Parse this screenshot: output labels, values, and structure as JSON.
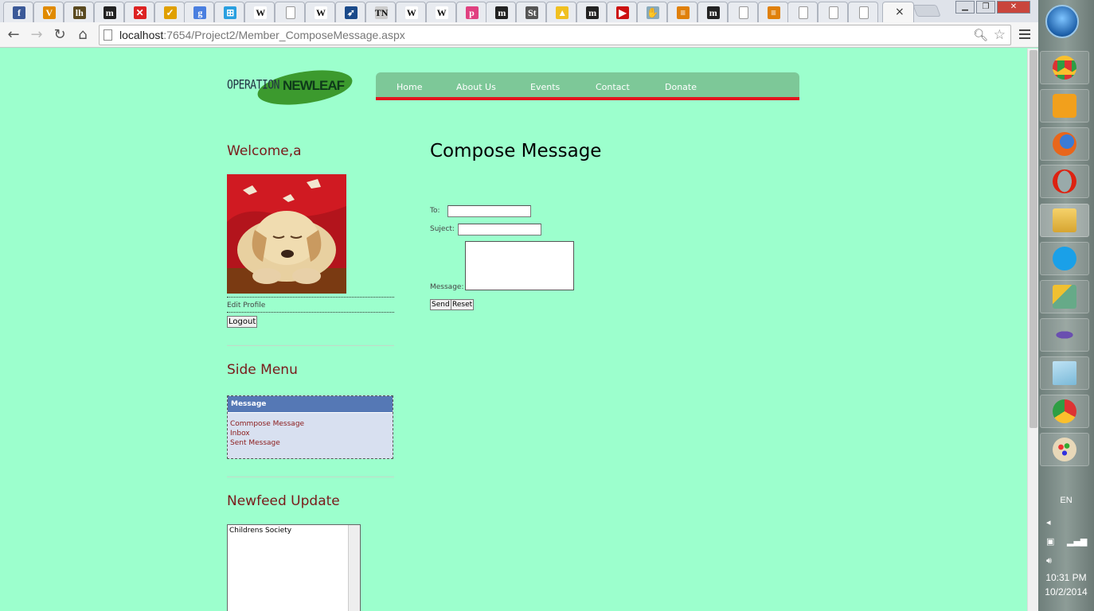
{
  "browser": {
    "url_host": "localhost",
    "url_path": ":7654/Project2/Member_ComposeMessage.aspx",
    "tabs": [
      {
        "icon": "facebook-icon",
        "glyph": "f",
        "color": "#3b5998"
      },
      {
        "icon": "v-icon",
        "glyph": "V",
        "color": "#e08a00"
      },
      {
        "icon": "lh-icon",
        "glyph": "lh",
        "color": "#5a4a20"
      },
      {
        "icon": "m-icon",
        "glyph": "m",
        "color": "#222222"
      },
      {
        "icon": "x-app-icon",
        "glyph": "✕",
        "color": "#d22"
      },
      {
        "icon": "check-icon",
        "glyph": "✓",
        "color": "#e0a000"
      },
      {
        "icon": "google-icon",
        "glyph": "g",
        "color": "#4a7fe0"
      },
      {
        "icon": "windows-icon",
        "glyph": "⊞",
        "color": "#2aa0e0"
      },
      {
        "icon": "wikipedia-icon",
        "glyph": "W",
        "color": "#ffffff"
      },
      {
        "icon": "blank-page-icon",
        "glyph": "",
        "color": "#ffffff"
      },
      {
        "icon": "wikipedia-icon",
        "glyph": "W",
        "color": "#ffffff"
      },
      {
        "icon": "bird-icon",
        "glyph": "➶",
        "color": "#1a4a8a"
      },
      {
        "icon": "tn-icon",
        "glyph": "TN",
        "color": "#cccccc"
      },
      {
        "icon": "wikipedia-icon",
        "glyph": "W",
        "color": "#ffffff"
      },
      {
        "icon": "wikipedia-icon",
        "glyph": "W",
        "color": "#ffffff"
      },
      {
        "icon": "p-icon",
        "glyph": "p",
        "color": "#e04080"
      },
      {
        "icon": "m-icon",
        "glyph": "m",
        "color": "#222222"
      },
      {
        "icon": "st-icon",
        "glyph": "St",
        "color": "#555555"
      },
      {
        "icon": "drive-icon",
        "glyph": "▲",
        "color": "#f0c020"
      },
      {
        "icon": "m-icon",
        "glyph": "m",
        "color": "#222222"
      },
      {
        "icon": "youtube-icon",
        "glyph": "▶",
        "color": "#c11"
      },
      {
        "icon": "hand-icon",
        "glyph": "✋",
        "color": "#8ab"
      },
      {
        "icon": "stack-icon",
        "glyph": "≡",
        "color": "#e0800a"
      },
      {
        "icon": "m-icon",
        "glyph": "m",
        "color": "#222222"
      },
      {
        "icon": "blank-page-icon",
        "glyph": "",
        "color": "#ffffff"
      },
      {
        "icon": "stack-icon",
        "glyph": "≡",
        "color": "#e0800a"
      },
      {
        "icon": "blank-page-icon",
        "glyph": "",
        "color": "#ffffff"
      },
      {
        "icon": "blank-page-icon",
        "glyph": "",
        "color": "#ffffff"
      },
      {
        "icon": "blank-page-icon",
        "glyph": "",
        "color": "#ffffff"
      }
    ],
    "active_tab_close": "×"
  },
  "logo": {
    "part1": "OPERATION",
    "part2": "NEWLEAF"
  },
  "nav": [
    "Home",
    "About Us",
    "Events",
    "Contact",
    "Donate"
  ],
  "sidebar": {
    "welcome": "Welcome,a",
    "edit_profile": "Edit Profile",
    "logout": "Logout",
    "side_menu_title": "Side Menu",
    "menu_header": "Message",
    "menu_items": [
      "Commpose Message",
      "Inbox",
      "Sent Message"
    ],
    "news_title": "Newfeed Update",
    "news_items": [
      "Childrens Society"
    ]
  },
  "compose": {
    "title": "Compose Message",
    "to_label": "To:",
    "to_value": "",
    "subject_label": "Suject:",
    "subject_value": "",
    "message_label": "Message:",
    "message_value": "",
    "send": "Send",
    "reset": "Reset"
  },
  "taskbar": {
    "language": "EN",
    "time": "10:31 PM",
    "date": "10/2/2014",
    "apps": [
      "chrome-icon",
      "media-player-icon",
      "firefox-icon",
      "opera-icon",
      "file-explorer-icon",
      "skype-icon",
      "tools-icon",
      "visual-studio-icon",
      "notepad-icon",
      "chrome-icon",
      "paint-icon"
    ]
  }
}
